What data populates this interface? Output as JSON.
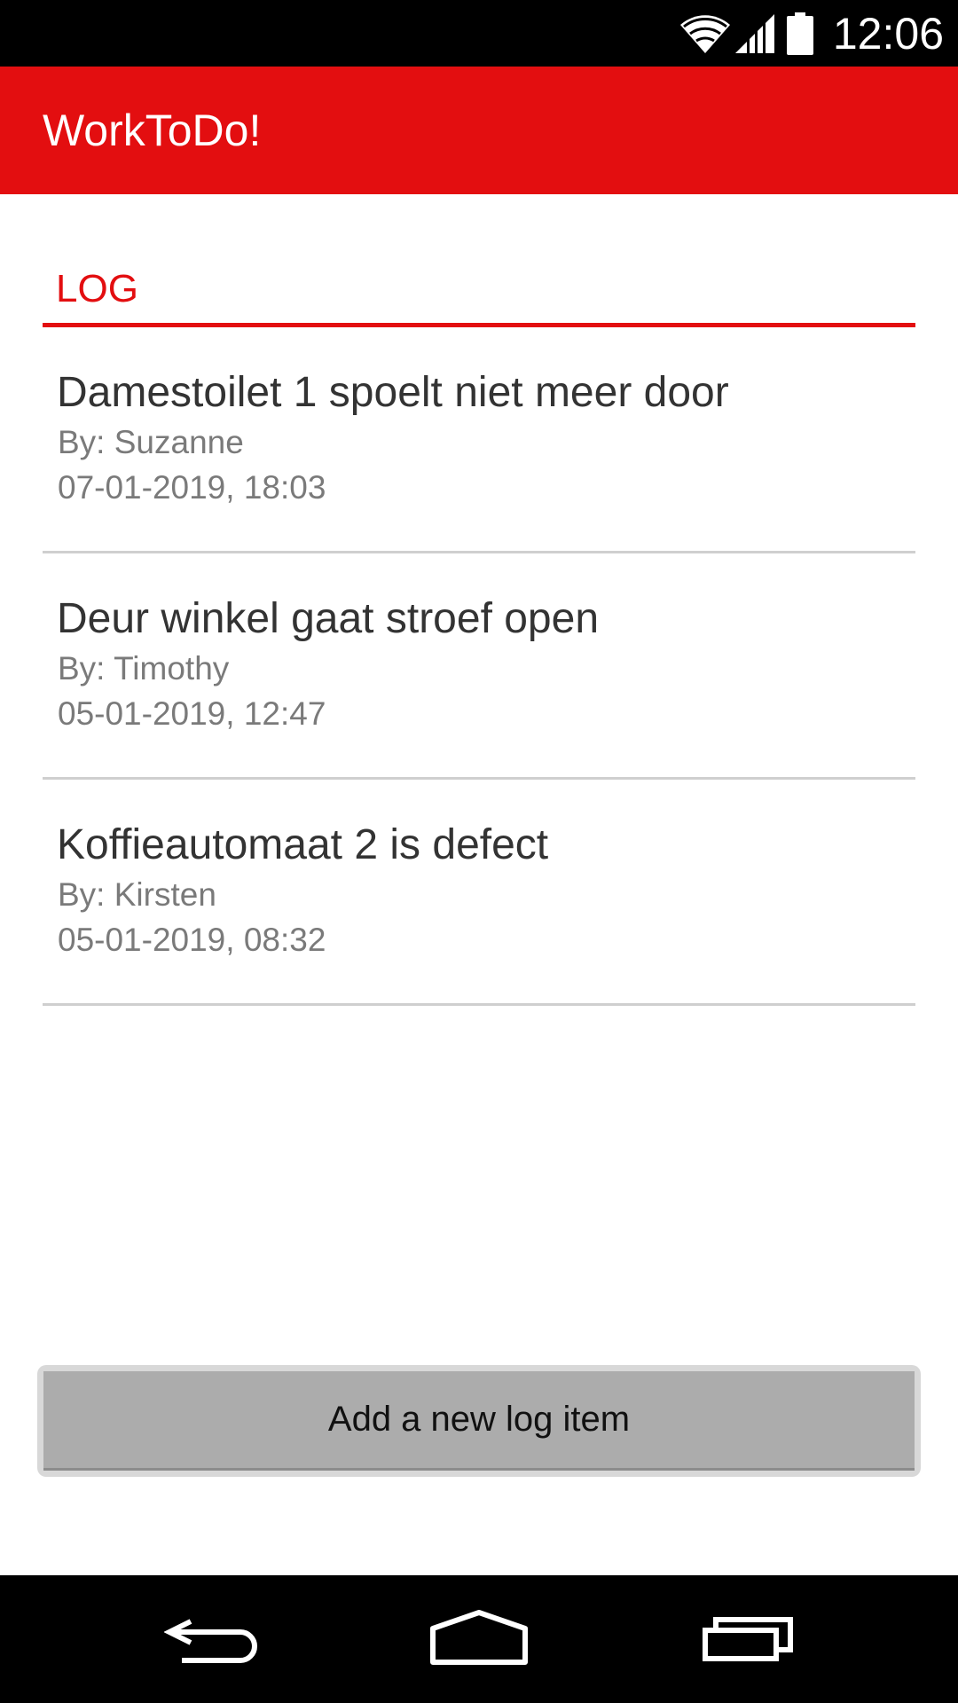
{
  "status_bar": {
    "time": "12:06",
    "icons": [
      "wifi-icon",
      "signal-icon",
      "battery-icon"
    ]
  },
  "app_bar": {
    "title": "WorkToDo!",
    "color": "#e30e10"
  },
  "log_section": {
    "title": "LOG",
    "items": [
      {
        "title": "Damestoilet 1 spoelt niet meer door",
        "author": "By: Suzanne",
        "date": "07-01-2019, 18:03"
      },
      {
        "title": "Deur winkel gaat stroef open",
        "author": "By: Timothy",
        "date": "05-01-2019, 12:47"
      },
      {
        "title": "Koffieautomaat 2 is defect",
        "author": "By: Kirsten",
        "date": "05-01-2019, 08:32"
      }
    ]
  },
  "actions": {
    "add_label": "Add a new log item"
  },
  "nav_bar": {
    "buttons": [
      "back-icon",
      "home-icon",
      "recent-apps-icon"
    ]
  }
}
